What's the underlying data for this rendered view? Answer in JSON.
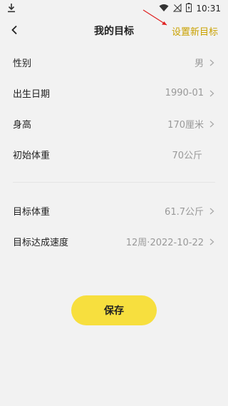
{
  "status_bar": {
    "time": "10:31",
    "icons": [
      "download-icon",
      "wifi-icon",
      "signal-icon",
      "battery-icon"
    ]
  },
  "header": {
    "title": "我的目标",
    "action_label": "设置新目标",
    "accent_color": "#c9a100"
  },
  "profile": {
    "rows": [
      {
        "label": "性别",
        "value": "男",
        "has_chevron": true
      },
      {
        "label": "出生日期",
        "value": "1990-01",
        "has_chevron": true
      },
      {
        "label": "身高",
        "value": "170厘米",
        "has_chevron": true
      },
      {
        "label": "初始体重",
        "value": "70公斤",
        "has_chevron": false
      }
    ]
  },
  "goal": {
    "rows": [
      {
        "label": "目标体重",
        "value": "61.7公斤",
        "has_chevron": true
      },
      {
        "label": "目标达成速度",
        "value": "12周·2022-10-22",
        "has_chevron": true
      }
    ]
  },
  "save_button": {
    "label": "保存",
    "color": "#f7df3e"
  }
}
